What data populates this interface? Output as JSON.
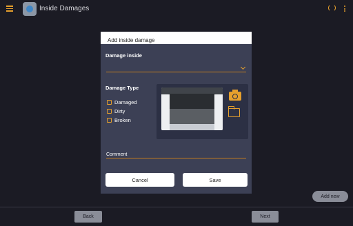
{
  "appbar": {
    "title": "Inside Damages",
    "icons": [
      "menu-icon",
      "app-logo",
      "sync-icon",
      "more-icon"
    ]
  },
  "dialog": {
    "title": "Add inside damage",
    "damage_inside_label": "Damage inside",
    "damage_inside_value": "",
    "damage_type_label": "Damage Type",
    "damage_types": [
      {
        "label": "Damaged",
        "checked": false
      },
      {
        "label": "Dirty",
        "checked": false
      },
      {
        "label": "Broken",
        "checked": false
      }
    ],
    "comment_label": "Comment",
    "comment_value": "",
    "cancel_label": "Cancel",
    "save_label": "Save"
  },
  "fab": {
    "add_new_label": "Add new"
  },
  "footer": {
    "back_label": "Back",
    "next_label": "Next"
  },
  "colors": {
    "accent": "#e6a02d",
    "background": "#1b1b24",
    "dialog": "#3c4055",
    "panel": "#2c3044"
  }
}
